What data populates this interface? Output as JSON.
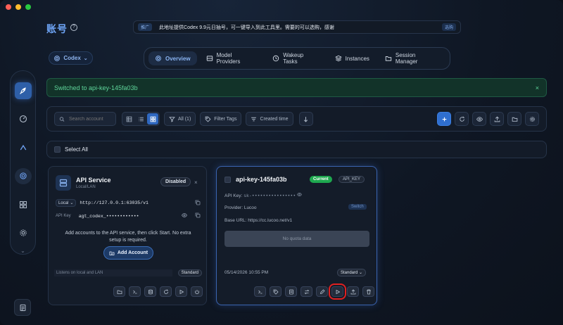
{
  "header": {
    "title": "账号",
    "notice_tag": "推广",
    "notice_text": "此地址提供Codex 9.9元日抽号，可一键导入到此工具里。需要的可以选购，感谢",
    "notice_link": "选购"
  },
  "platform_select": {
    "value": "Codex"
  },
  "tabs": [
    {
      "label": "Overview"
    },
    {
      "label": "Model Providers"
    },
    {
      "label": "Wakeup Tasks"
    },
    {
      "label": "Instances"
    },
    {
      "label": "Session Manager"
    }
  ],
  "toast": {
    "message": "Switched to api-key-145fa03b",
    "close": "×"
  },
  "toolbar": {
    "search_placeholder": "Search account",
    "filter_all": "All (1)",
    "filter_tags": "Filter Tags",
    "sort": "Created time"
  },
  "select_all": "Select All",
  "api_service": {
    "title": "API Service",
    "subtitle": "Local/LAN",
    "status_button": "Disabled",
    "close": "×",
    "scope": "Local",
    "url": "http://127.0.0.1:63035/v1",
    "api_key_label": "API Key",
    "api_key_value": "agt_codex_••••••••••••",
    "info": "Add accounts to the API service, then click Start. No extra setup is required.",
    "add_button": "Add Account",
    "listen_label": "Listens on local and LAN",
    "mode": "Standard"
  },
  "account": {
    "name": "api-key-145fa03b",
    "badge_current": "Current",
    "badge_type": "API_KEY",
    "api_key_label": "API Key:",
    "api_key_value": "sk-••••••••••••••••",
    "provider_label": "Provider:",
    "provider_value": "Lucoo",
    "switch_button": "Switch",
    "base_url_label": "Base URL:",
    "base_url_value": "https://cc.lucoo.net/v1",
    "quota_text": "No quota data",
    "date": "05/14/2026 10:55 PM",
    "mode": "Standard"
  },
  "colors": {
    "accent": "#2f6fd0",
    "success": "#1ea84f",
    "toast_text": "#5fd69b",
    "highlight": "#e02020"
  }
}
